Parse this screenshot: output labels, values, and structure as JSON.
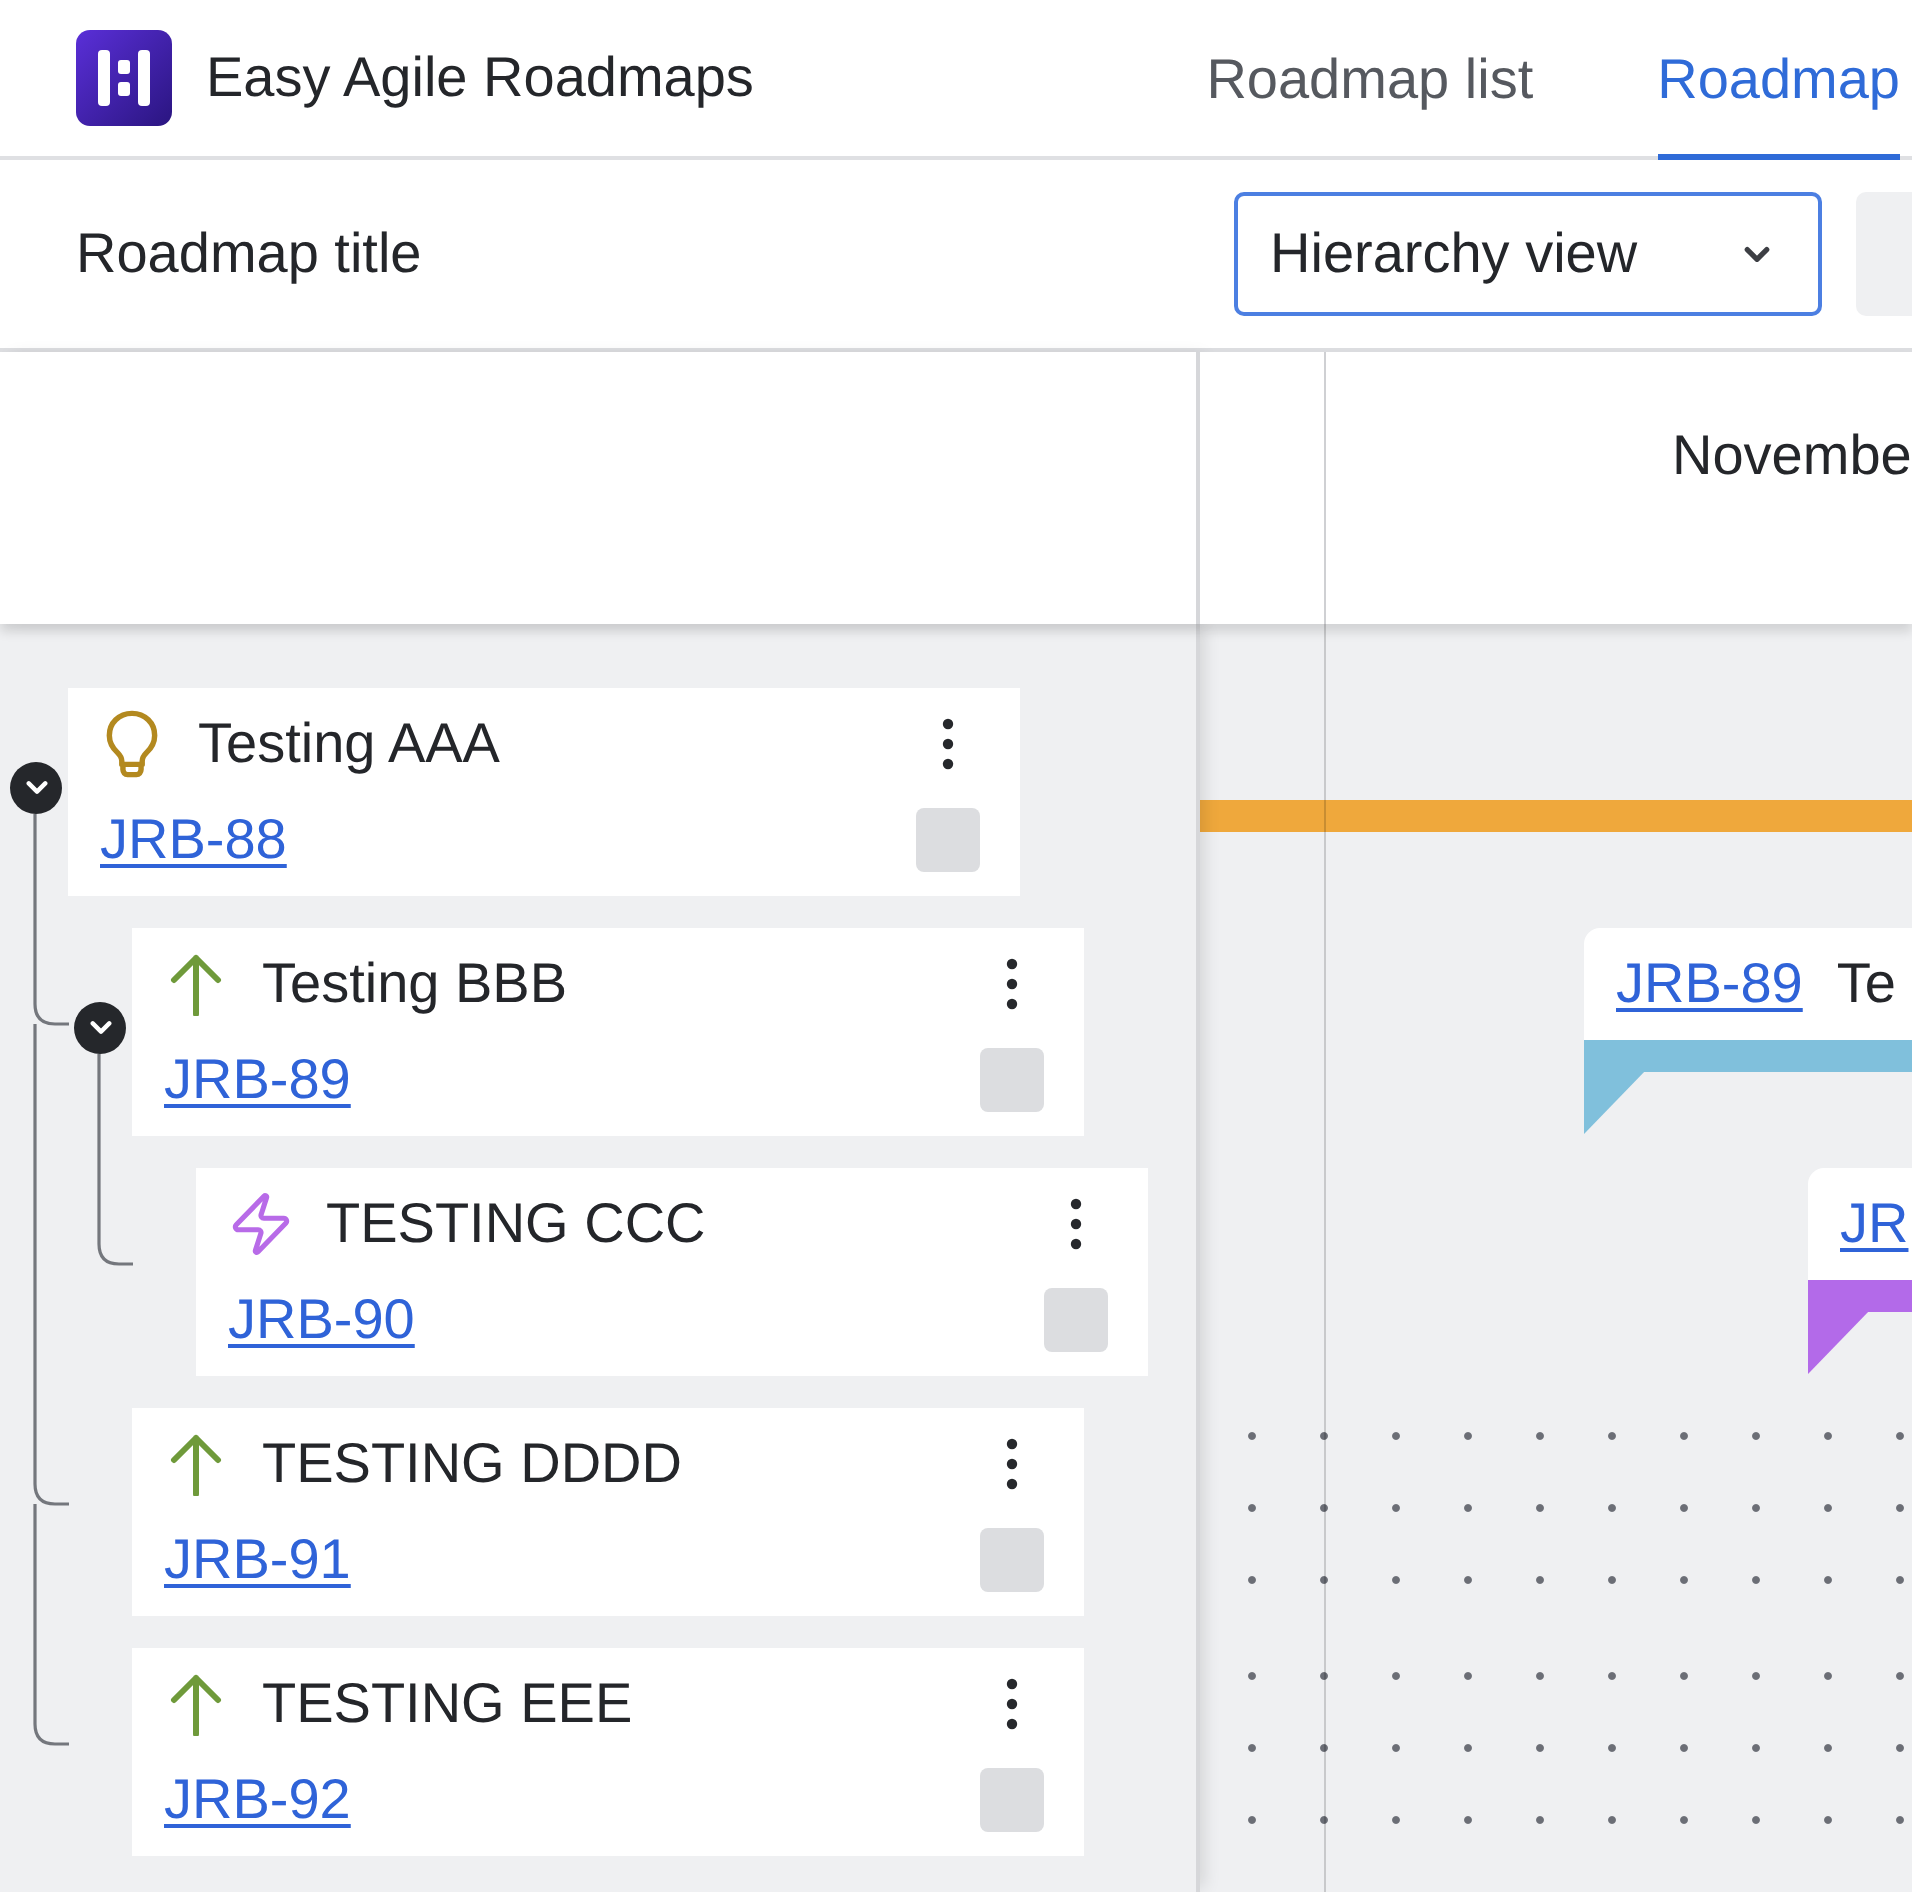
{
  "app": {
    "name": "Easy Agile Roadmaps"
  },
  "nav_tabs": [
    {
      "label": "Roadmap list",
      "selected": false
    },
    {
      "label": "Roadmap",
      "selected": true
    }
  ],
  "toolbar": {
    "title": "Roadmap title",
    "view_select": {
      "value": "Hierarchy view"
    }
  },
  "tree": [
    {
      "kind": "idea",
      "title": "Testing AAA",
      "key": "JRB-88",
      "expanded": true,
      "children": [
        {
          "kind": "improvement",
          "title": "Testing BBB",
          "key": "JRB-89",
          "expanded": true,
          "children": [
            {
              "kind": "epic",
              "title": "TESTING CCC",
              "key": "JRB-90"
            }
          ]
        },
        {
          "kind": "improvement",
          "title": "TESTING DDDD",
          "key": "JRB-91"
        },
        {
          "kind": "improvement",
          "title": "TESTING EEE",
          "key": "JRB-92"
        }
      ]
    }
  ],
  "timeline": {
    "month": "Novembe",
    "rows": [
      {
        "kind": "line",
        "color": "#efa83c"
      },
      {
        "kind": "card",
        "key": "JRB-89",
        "title": "Te",
        "color": "#80c0dc"
      },
      {
        "kind": "card",
        "key": "JR",
        "color": "#b36ae9"
      },
      {
        "kind": "unscheduled"
      },
      {
        "kind": "unscheduled"
      }
    ]
  }
}
